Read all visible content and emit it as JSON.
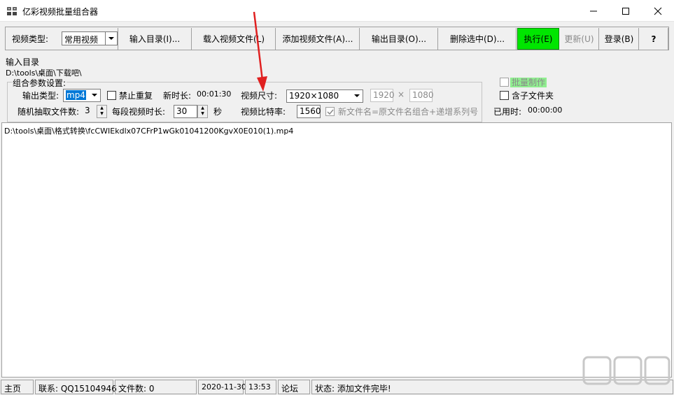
{
  "window": {
    "title": "亿彩视频批量组合器",
    "controls": {
      "minimize": "minimize",
      "maximize": "maximize",
      "close": "close"
    }
  },
  "toolbar": {
    "video_type_label": "视频类型:",
    "video_type_value": "常用视频",
    "buttons": {
      "input_dir": "输入目录(I)...",
      "load_video": "载入视频文件(L)",
      "add_video": "添加视频文件(A)...",
      "output_dir": "输出目录(O)...",
      "delete_selected": "删除选中(D)...",
      "execute": "执行(E)",
      "update": "更新(U)",
      "login": "登录(B)",
      "help": "?"
    }
  },
  "info": {
    "input_dir_label": "输入目录",
    "input_dir_path": "D:\\tools\\桌面\\下载吧\\"
  },
  "params": {
    "group_title": "组合参数设置:",
    "output_type_label": "输出类型:",
    "output_type_value": "mp4",
    "no_repeat_label": "禁止重复",
    "new_duration_label": "新时长:",
    "new_duration_value": "00:01:30",
    "video_size_label": "视频尺寸:",
    "video_size_value": "1920×1080",
    "width_value": "1920",
    "times_sign": "×",
    "height_value": "1080",
    "random_files_label": "随机抽取文件数:",
    "random_files_value": "3",
    "segment_duration_label": "每段视频时长:",
    "segment_duration_value": "30",
    "seconds_unit": "秒",
    "bitrate_label": "视频比特率:",
    "bitrate_value": "1560",
    "new_filename_label": "新文件名=原文件名组合+递增系列号"
  },
  "right_options": {
    "batch_label": "批量制作",
    "subfolder_label": "含子文件夹",
    "elapsed_label": "已用时:",
    "elapsed_value": "00:00:00"
  },
  "file_list": {
    "items": [
      "D:\\tools\\桌面\\格式转换\\fcCWIEkdlx07CFrP1wGk01041200KgvX0E010(1).mp4"
    ]
  },
  "statusbar": {
    "home": "主页",
    "contact": "联系: QQ15104946",
    "file_count": "文件数: 0",
    "date": "2020-11-30",
    "time": "13:53",
    "forum": "论坛",
    "status": "状态: 添加文件完毕!"
  },
  "colors": {
    "execute_bg": "#00e600",
    "batch_highlight": "#90ee90",
    "selection": "#0078d7",
    "arrow": "#e02020"
  },
  "watermark": {
    "text": "下载吧"
  }
}
